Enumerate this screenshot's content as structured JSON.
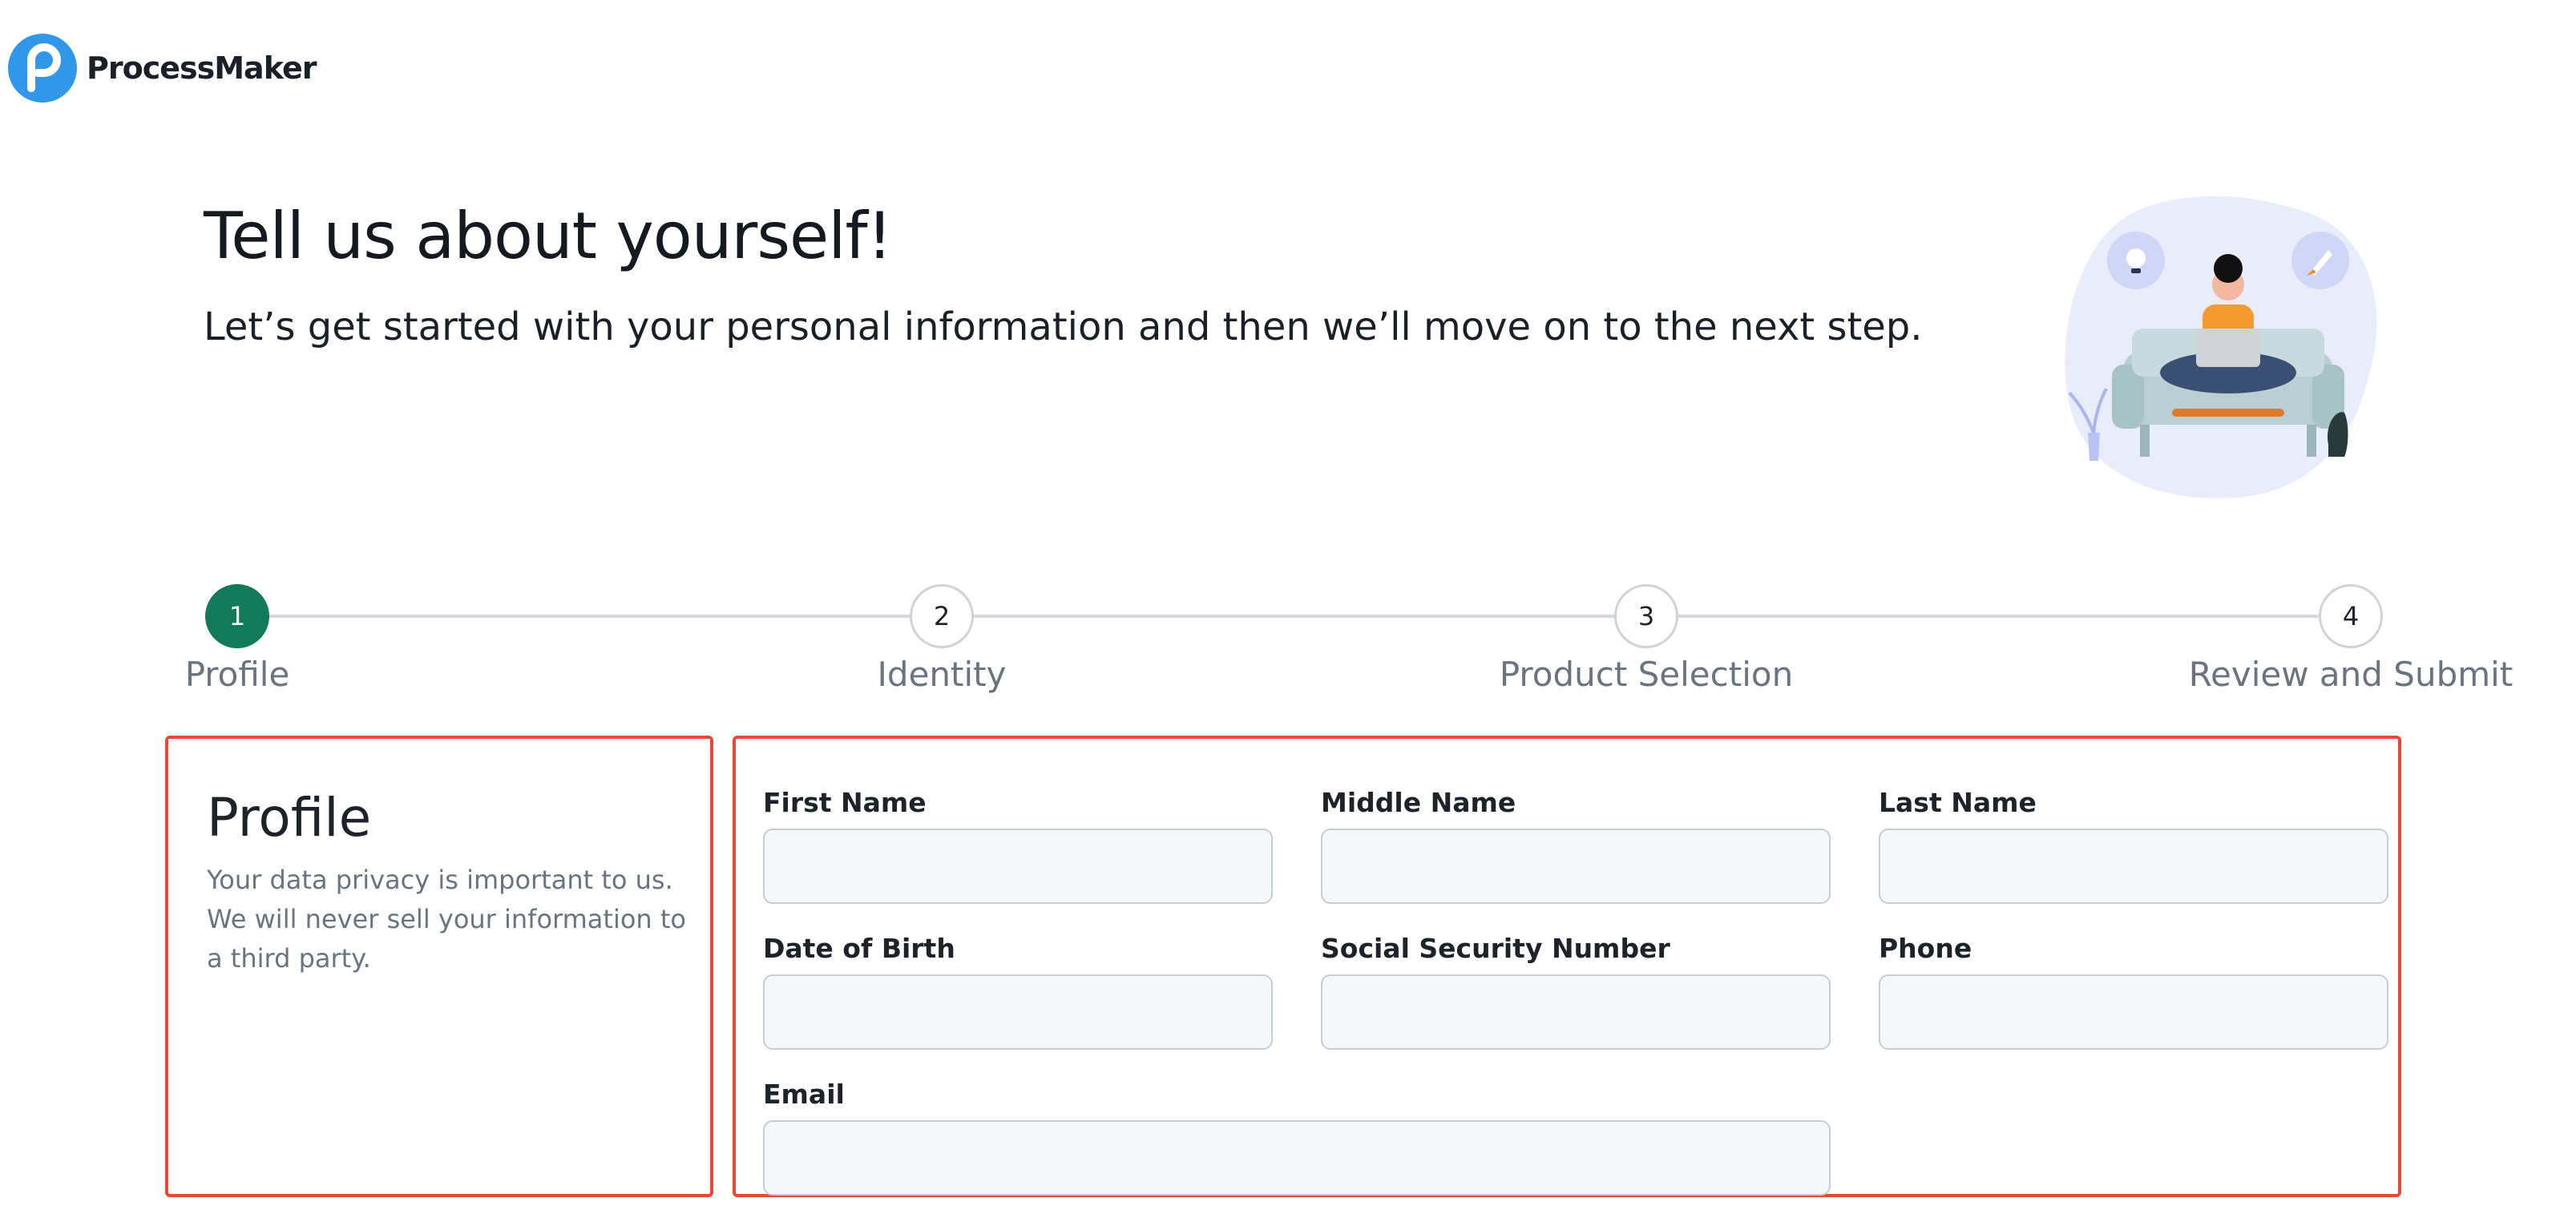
{
  "brand": {
    "name": "ProcessMaker",
    "color": "#3397e8"
  },
  "header": {
    "title": "Tell us about yourself!",
    "subtitle": "Let’s get started with your personal information and then we’ll move on to the next step."
  },
  "illustration": {
    "icon": "person-with-laptop-illustration"
  },
  "stepper": {
    "active_step": 1,
    "active_color": "#137a59",
    "steps": [
      {
        "number": "1",
        "label": "Profile"
      },
      {
        "number": "2",
        "label": "Identity"
      },
      {
        "number": "3",
        "label": "Product Selection"
      },
      {
        "number": "4",
        "label": "Review and Submit"
      }
    ]
  },
  "profile": {
    "title": "Profile",
    "description": "Your data privacy is important to us. We will never sell your information to a third party."
  },
  "form": {
    "first_name": {
      "label": "First Name",
      "value": ""
    },
    "middle_name": {
      "label": "Middle Name",
      "value": ""
    },
    "last_name": {
      "label": "Last Name",
      "value": ""
    },
    "date_of_birth": {
      "label": "Date of Birth",
      "value": ""
    },
    "ssn": {
      "label": "Social Security Number",
      "value": ""
    },
    "phone": {
      "label": "Phone",
      "value": ""
    },
    "email": {
      "label": "Email",
      "value": ""
    }
  },
  "highlight_color": "#e8483a"
}
